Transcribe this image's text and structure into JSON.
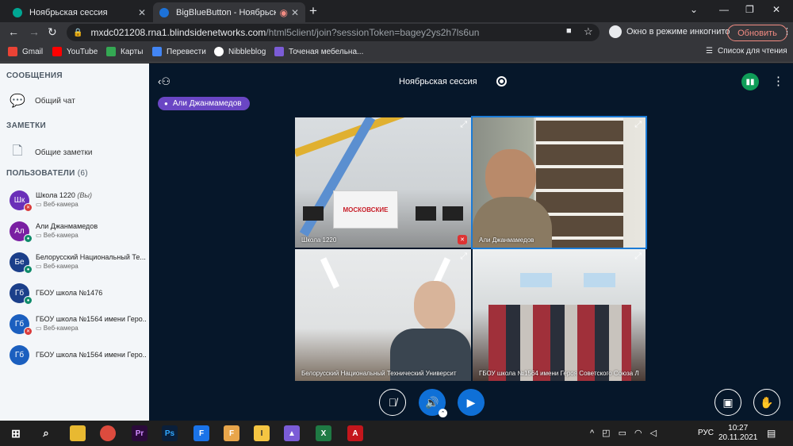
{
  "browser": {
    "tabs": [
      {
        "title": "Ноябрьская сессия",
        "favicon_color": "#00a693"
      },
      {
        "title": "BigBlueButton - Ноябрьская",
        "favicon_color": "#1d72d8",
        "active": true
      }
    ],
    "url_host": "mxdc021208.rna1.blindsidenetworks.com",
    "url_path": "/html5client/join?sessionToken=bagey2ys2h7ls6un",
    "incognito_label": "Окно в режиме инкогнито",
    "update_button": "Обновить",
    "bookmarks": [
      {
        "label": "Gmail",
        "color": "#ea4335"
      },
      {
        "label": "YouTube",
        "color": "#ff0000"
      },
      {
        "label": "Карты",
        "color": "#34a853"
      },
      {
        "label": "Перевести",
        "color": "#4285f4"
      },
      {
        "label": "Nibbleblog",
        "color": "#ffffff"
      },
      {
        "label": "Точеная мебельна...",
        "color": "#7b5cd6"
      }
    ],
    "reading_list": "Список для чтения"
  },
  "sidebar": {
    "messages_title": "СООБЩЕНИЯ",
    "public_chat": "Общий чат",
    "notes_title": "ЗАМЕТКИ",
    "shared_notes": "Общие заметки",
    "users_title": "ПОЛЬЗОВАТЕЛИ",
    "users_count": "(6)",
    "users": [
      {
        "initials": "Шк",
        "name": "Школа 1220",
        "you": "(Вы)",
        "status": "Веб-камера",
        "color": "#6a2fb8",
        "badge": "#d93a3a"
      },
      {
        "initials": "Ал",
        "name": "Али Джанмамедов",
        "status": "Веб-камера",
        "color": "#7a1fa2",
        "badge": "#0f8a6a"
      },
      {
        "initials": "Бе",
        "name": "Белорусский Национальный Те...",
        "status": "Веб-камера",
        "color": "#1b3f8a",
        "badge": "#0f8a6a"
      },
      {
        "initials": "Гб",
        "name": "ГБОУ школа №1476",
        "status": "",
        "color": "#1b3f8a",
        "badge": "#0f8a6a"
      },
      {
        "initials": "Гб",
        "name": "ГБОУ школа №1564 имени Геро...",
        "status": "Веб-камера",
        "color": "#1b5fbf",
        "badge": "#d93a3a"
      },
      {
        "initials": "Гб",
        "name": "ГБОУ школа №1564 имени Геро...",
        "status": "",
        "color": "#1b5fbf",
        "badge": ""
      }
    ]
  },
  "meeting": {
    "title": "Ноябрьская сессия",
    "talking": "Али Джанмамедов",
    "videos": [
      {
        "name": "Школа 1220",
        "banner": "МОСКОВСКИЕ"
      },
      {
        "name": "Али Джанмамедов"
      },
      {
        "name": "Белорусский Национальный Технический Университ"
      },
      {
        "name": "ГБОУ школа №1564 имени Героя Советского Союза Л"
      }
    ]
  },
  "taskbar": {
    "lang": "РУС",
    "time": "10:27",
    "date": "20.11.2021"
  }
}
